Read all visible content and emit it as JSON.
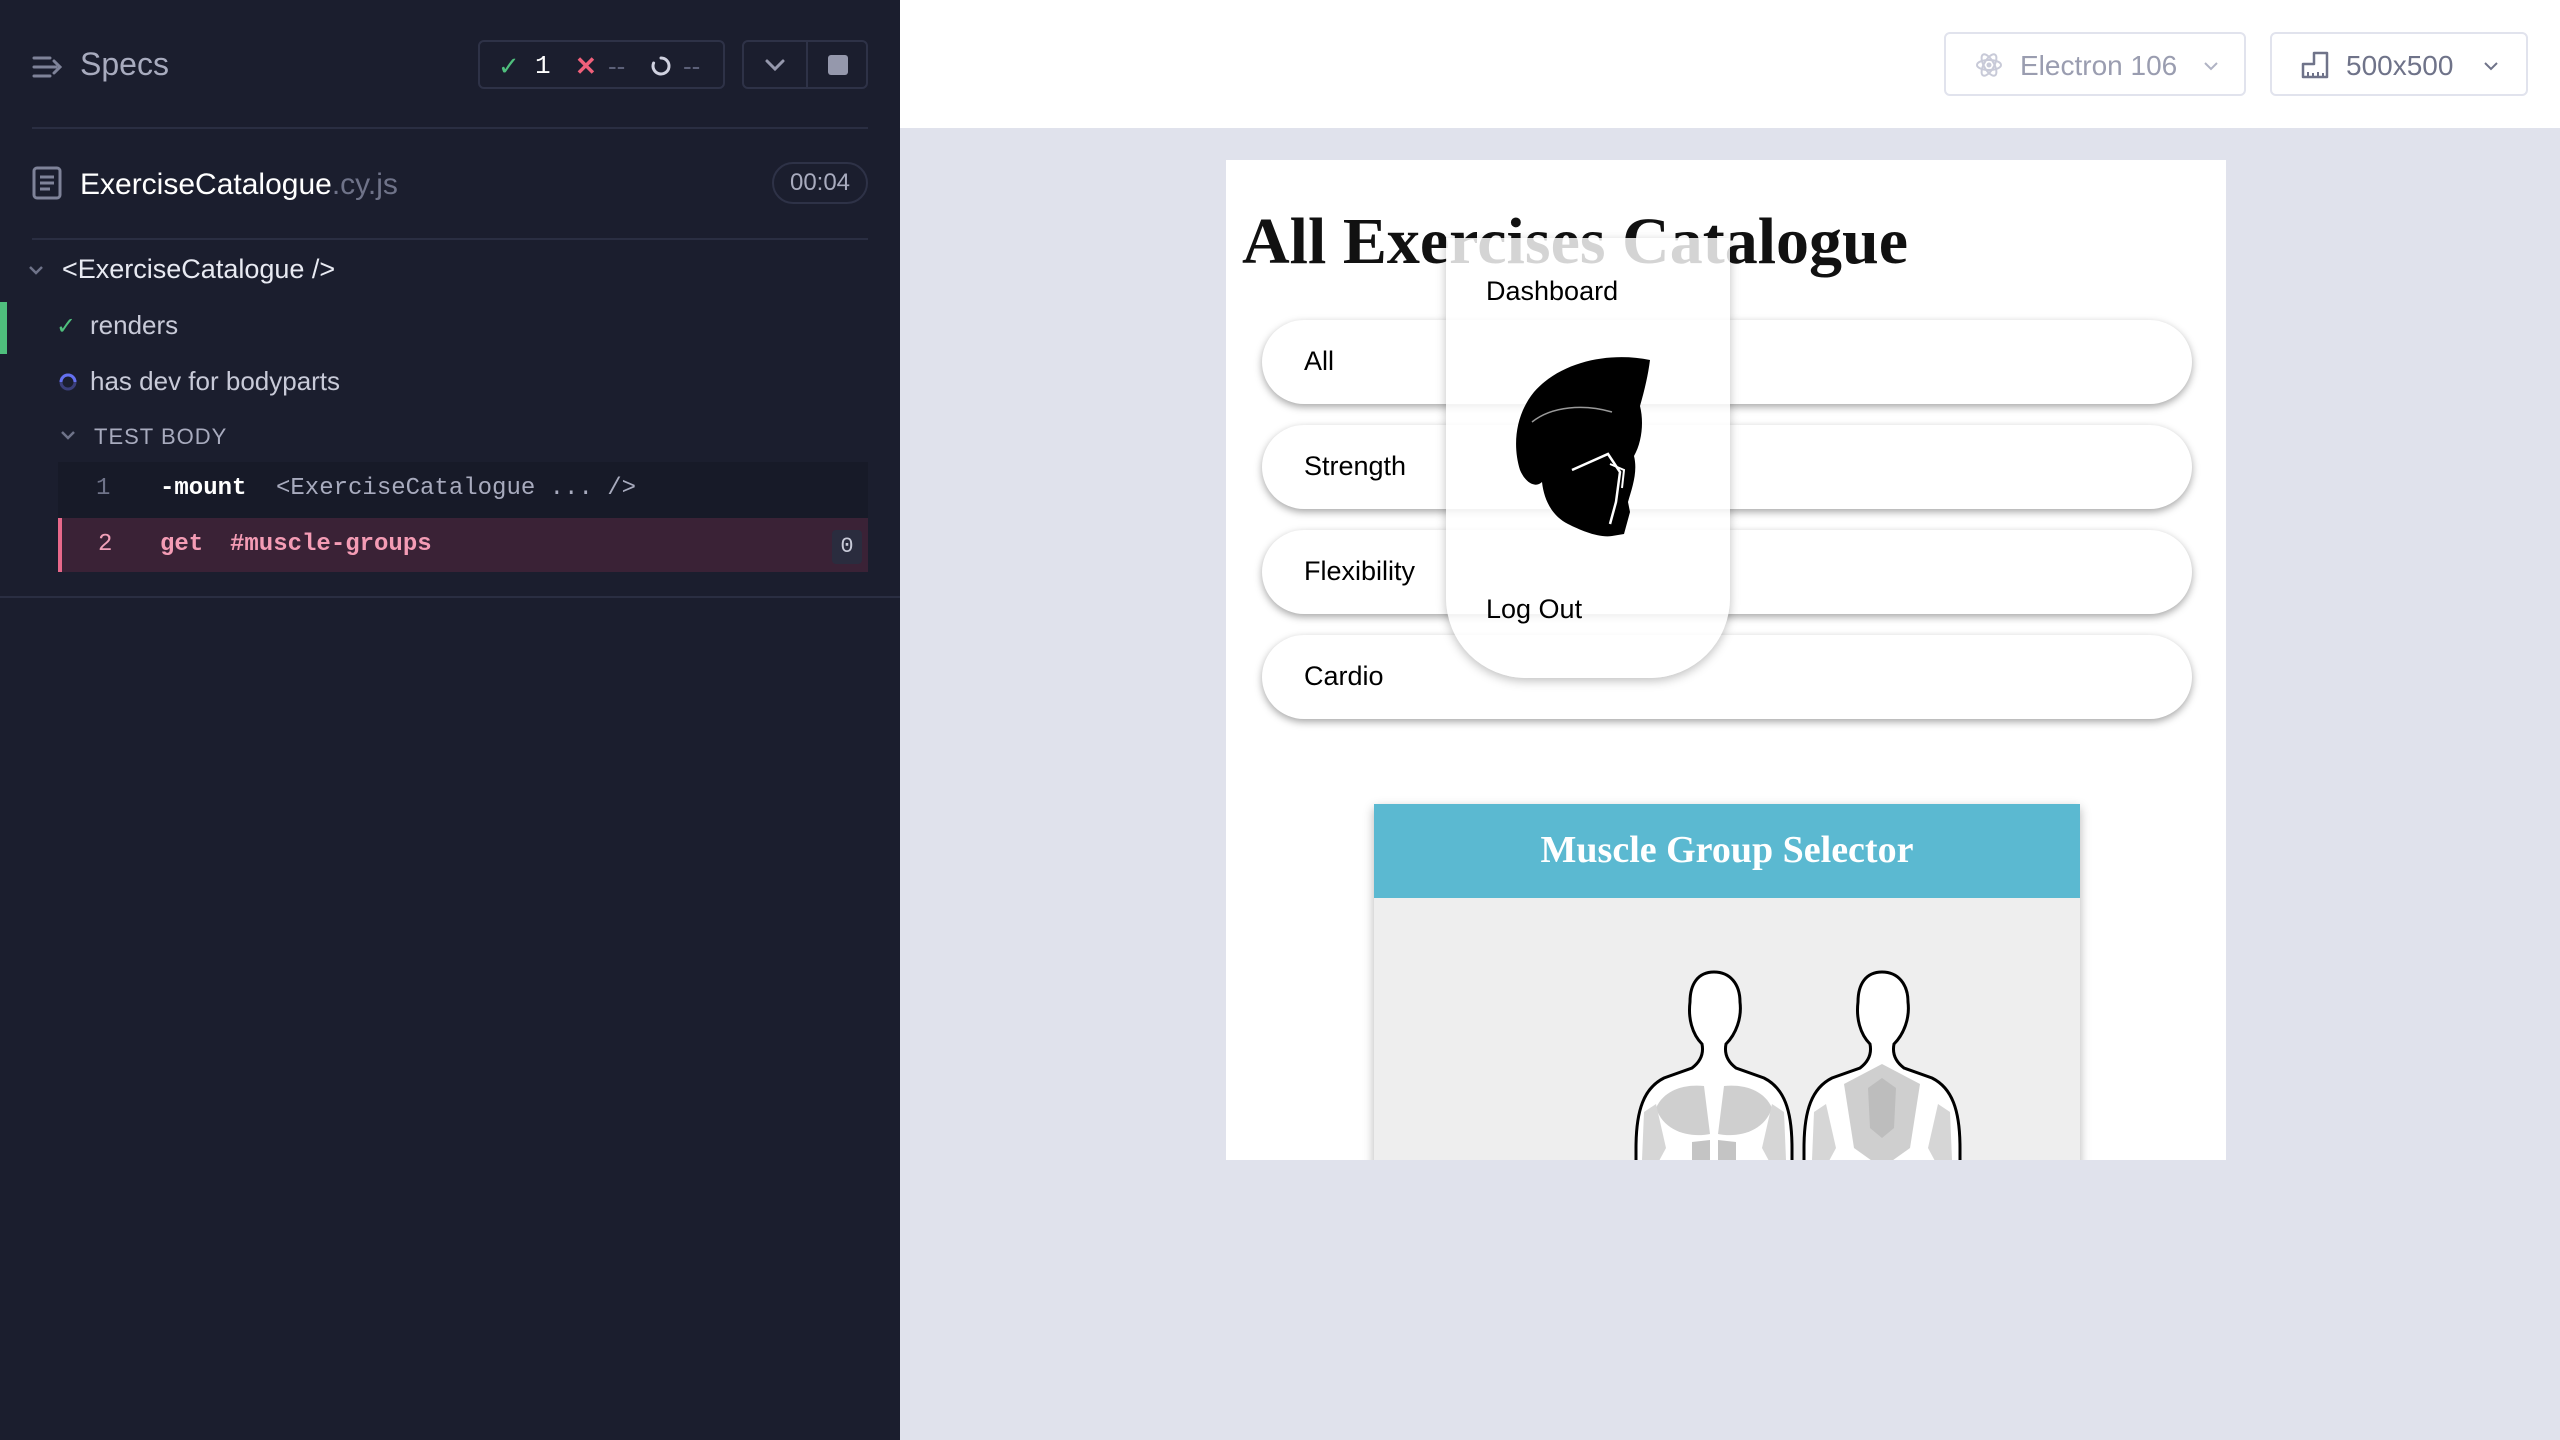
{
  "reporter": {
    "specs_title": "Specs",
    "stats": {
      "passed": "1",
      "failed": "--",
      "pending": "--"
    },
    "file": {
      "name": "ExerciseCatalogue",
      "ext": ".cy.js",
      "duration": "00:04"
    },
    "suite": {
      "title": "<ExerciseCatalogue />",
      "tests": [
        {
          "title": "renders",
          "state": "passed"
        },
        {
          "title": "has dev for bodyparts",
          "state": "running"
        }
      ],
      "test_body_label": "TEST BODY",
      "commands": [
        {
          "num": "1",
          "name": "-mount",
          "message": "<ExerciseCatalogue ... />"
        },
        {
          "num": "2",
          "name": "get",
          "message": "#muscle-groups",
          "badge": "0"
        }
      ]
    }
  },
  "toolbar": {
    "browser": "Electron 106",
    "viewport": "500x500"
  },
  "app": {
    "title": "All Exercises Catalogue",
    "categories": [
      "All",
      "Strength",
      "Flexibility",
      "Cardio"
    ],
    "nav": {
      "dashboard": "Dashboard",
      "logout": "Log Out"
    },
    "muscle_selector_title": "Muscle Group Selector"
  },
  "colors": {
    "reporter_bg": "#1b1e2e",
    "pass": "#4fbf7d",
    "fail": "#f0607a",
    "running": "#6470f0",
    "selector_header": "#5bb9d1"
  }
}
